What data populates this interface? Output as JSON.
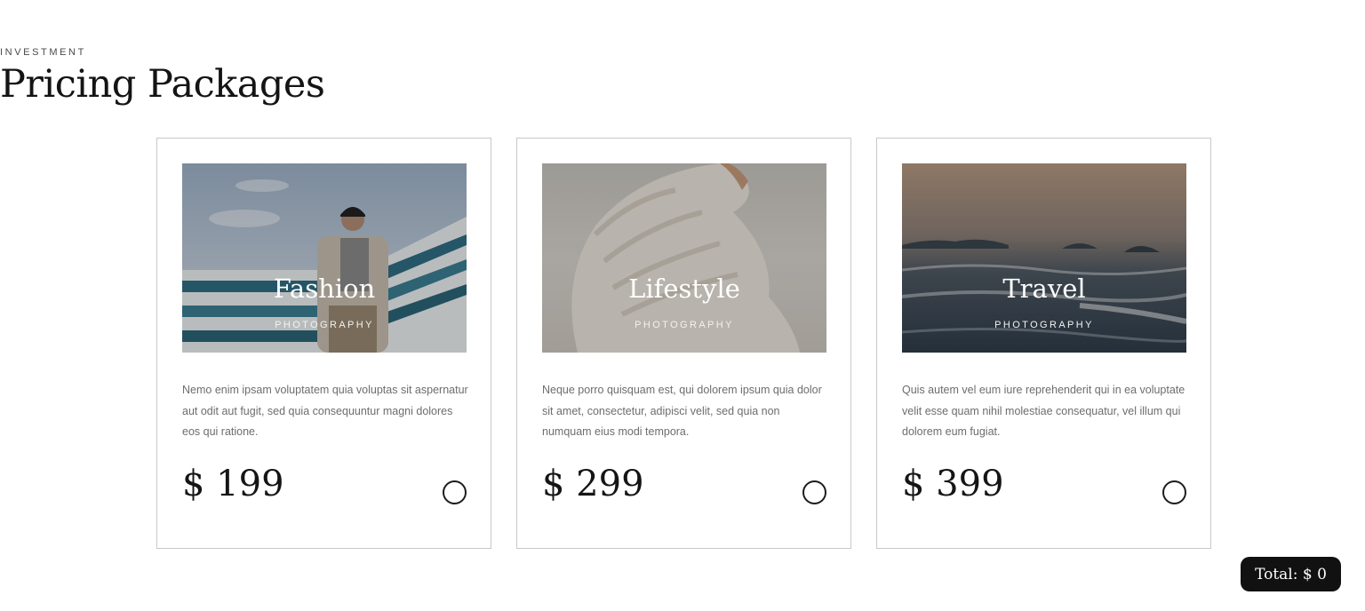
{
  "header": {
    "eyebrow": "INVESTMENT",
    "title": "Pricing Packages"
  },
  "packages": [
    {
      "title": "Fashion",
      "subtitle": "PHOTOGRAPHY",
      "description": "Nemo enim ipsam voluptatem quia voluptas sit aspernatur aut odit aut fugit, sed quia consequuntur magni dolores eos qui ratione.",
      "price": "$ 199",
      "selected": false
    },
    {
      "title": "Lifestyle",
      "subtitle": "PHOTOGRAPHY",
      "description": "Neque porro quisquam est, qui dolorem ipsum quia dolor sit amet, consectetur, adipisci velit, sed quia non numquam eius modi tempora.",
      "price": "$ 299",
      "selected": false
    },
    {
      "title": "Travel",
      "subtitle": "PHOTOGRAPHY",
      "description": "Quis autem vel eum iure reprehenderit qui in ea voluptate velit esse quam nihil molestiae consequatur, vel illum qui dolorem eum fugiat.",
      "price": "$ 399",
      "selected": false
    }
  ],
  "total": {
    "label": "Total: $ 0"
  }
}
